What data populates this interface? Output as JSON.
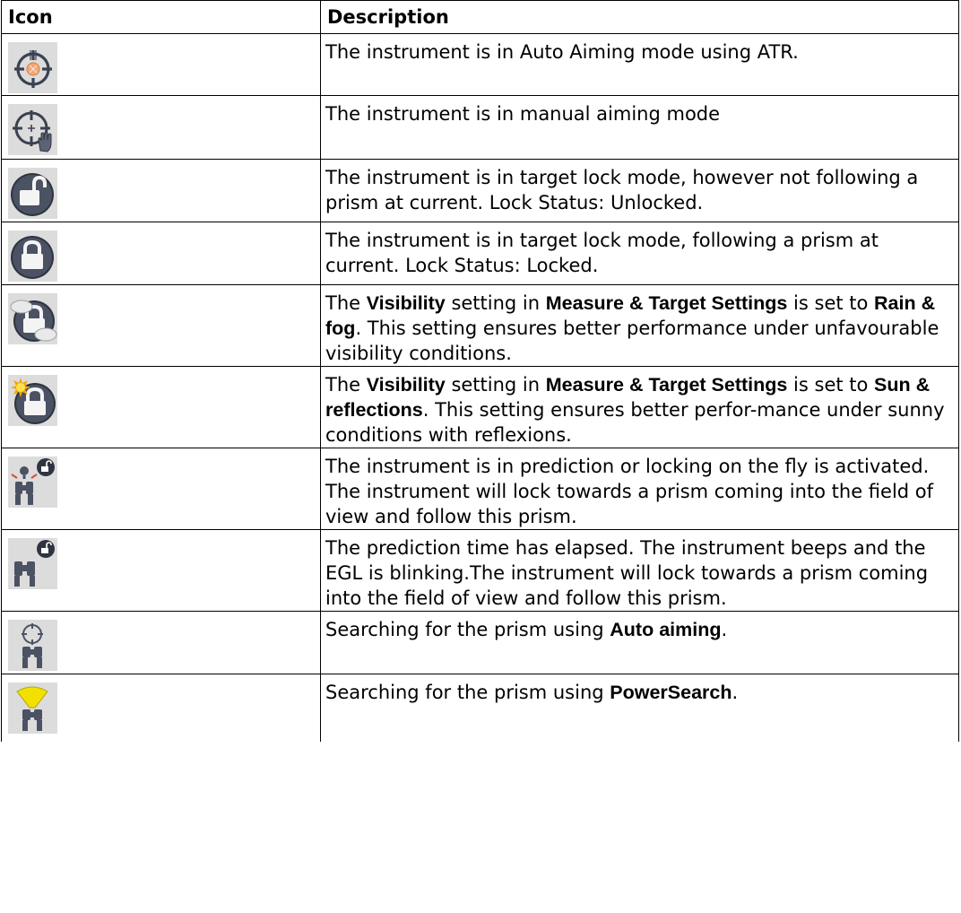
{
  "header": {
    "icon": "Icon",
    "description": "Description"
  },
  "rows": [
    {
      "icon": "crosshair-atr-icon",
      "parts": [
        {
          "t": "The instrument is in Auto Aiming mode using ATR."
        }
      ]
    },
    {
      "icon": "crosshair-manual-hand-icon",
      "parts": [
        {
          "t": "The instrument is in manual aiming mode"
        }
      ]
    },
    {
      "icon": "padlock-unlocked-icon",
      "parts": [
        {
          "t": "The instrument is in target lock mode, however not following a prism at current. Lock Status: Unlocked."
        }
      ]
    },
    {
      "icon": "padlock-locked-icon",
      "parts": [
        {
          "t": "The instrument is in target lock mode, following a prism at current. Lock Status: Locked."
        }
      ]
    },
    {
      "icon": "padlock-rain-fog-icon",
      "parts": [
        {
          "t": "The "
        },
        {
          "t": "Visibility",
          "b": true
        },
        {
          "t": " setting in "
        },
        {
          "t": "Measure & Target Settings",
          "b": true
        },
        {
          "t": " is set to "
        },
        {
          "t": "Rain & fog",
          "b": true
        },
        {
          "t": ". This setting ensures better performance under unfavourable visibility conditions."
        }
      ]
    },
    {
      "icon": "padlock-sun-reflections-icon",
      "parts": [
        {
          "t": "The "
        },
        {
          "t": "Visibility",
          "b": true
        },
        {
          "t": " setting in "
        },
        {
          "t": "Measure & Target Settings",
          "b": true
        },
        {
          "t": " is set to "
        },
        {
          "t": "Sun & reflections",
          "b": true
        },
        {
          "t": ". This setting ensures better perfor-mance under sunny conditions with reflexions."
        }
      ]
    },
    {
      "icon": "prediction-lock-on-fly-icon",
      "parts": [
        {
          "t": "The instrument is in prediction or locking on the fly is activated. The instrument will lock towards a prism coming into the field of view and follow this prism."
        }
      ]
    },
    {
      "icon": "prediction-elapsed-icon",
      "parts": [
        {
          "t": "The prediction time has elapsed. The instrument beeps and the EGL is blinking.The instrument will lock towards a prism coming into the field of view and follow this prism."
        }
      ]
    },
    {
      "icon": "search-auto-aiming-icon",
      "parts": [
        {
          "t": "Searching for the prism using "
        },
        {
          "t": "Auto aiming",
          "b": true
        },
        {
          "t": "."
        }
      ]
    },
    {
      "icon": "powersearch-icon",
      "parts": [
        {
          "t": "Searching for the prism using "
        },
        {
          "t": "PowerSearch",
          "b": true
        },
        {
          "t": "."
        }
      ]
    }
  ]
}
